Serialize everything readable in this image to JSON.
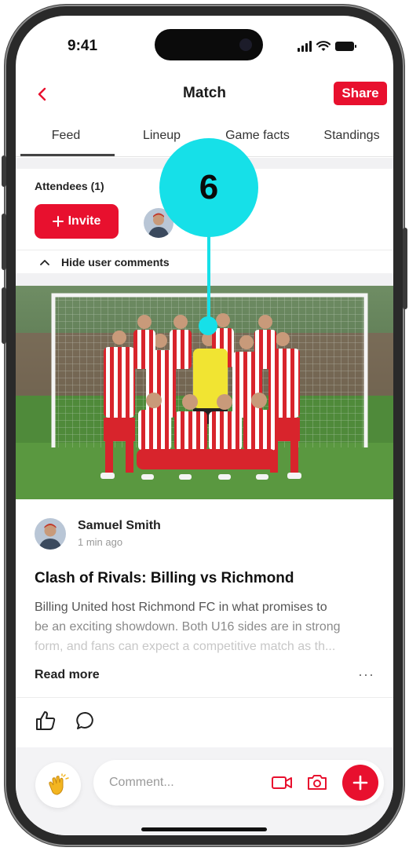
{
  "status_bar": {
    "time": "9:41"
  },
  "header": {
    "title": "Match",
    "share_label": "Share"
  },
  "tabs": [
    {
      "label": "Feed",
      "active": true
    },
    {
      "label": "Lineup",
      "active": false
    },
    {
      "label": "Game facts",
      "active": false
    },
    {
      "label": "Standings",
      "active": false
    }
  ],
  "attendees": {
    "label": "Attendees (1)",
    "invite_label": "Invite"
  },
  "comments_toggle": {
    "label": "Hide user comments"
  },
  "post": {
    "author": "Samuel Smith",
    "time": "1 min ago",
    "title": "Clash of Rivals: Billing vs Richmond",
    "body_lines": [
      "Billing United host Richmond FC in what promises to",
      "be an exciting showdown. Both U16 sides are in strong",
      "form, and fans can expect a competitive match as th..."
    ],
    "read_more": "Read more",
    "more": "···"
  },
  "composer": {
    "placeholder": "Comment..."
  },
  "callout": {
    "number": "6"
  },
  "colors": {
    "accent": "#e8102e",
    "callout": "#16e0e8"
  },
  "icons": [
    "back-icon",
    "plus-icon",
    "chevron-up-icon",
    "like-icon",
    "comment-icon",
    "clap-icon",
    "video-icon",
    "camera-icon"
  ]
}
